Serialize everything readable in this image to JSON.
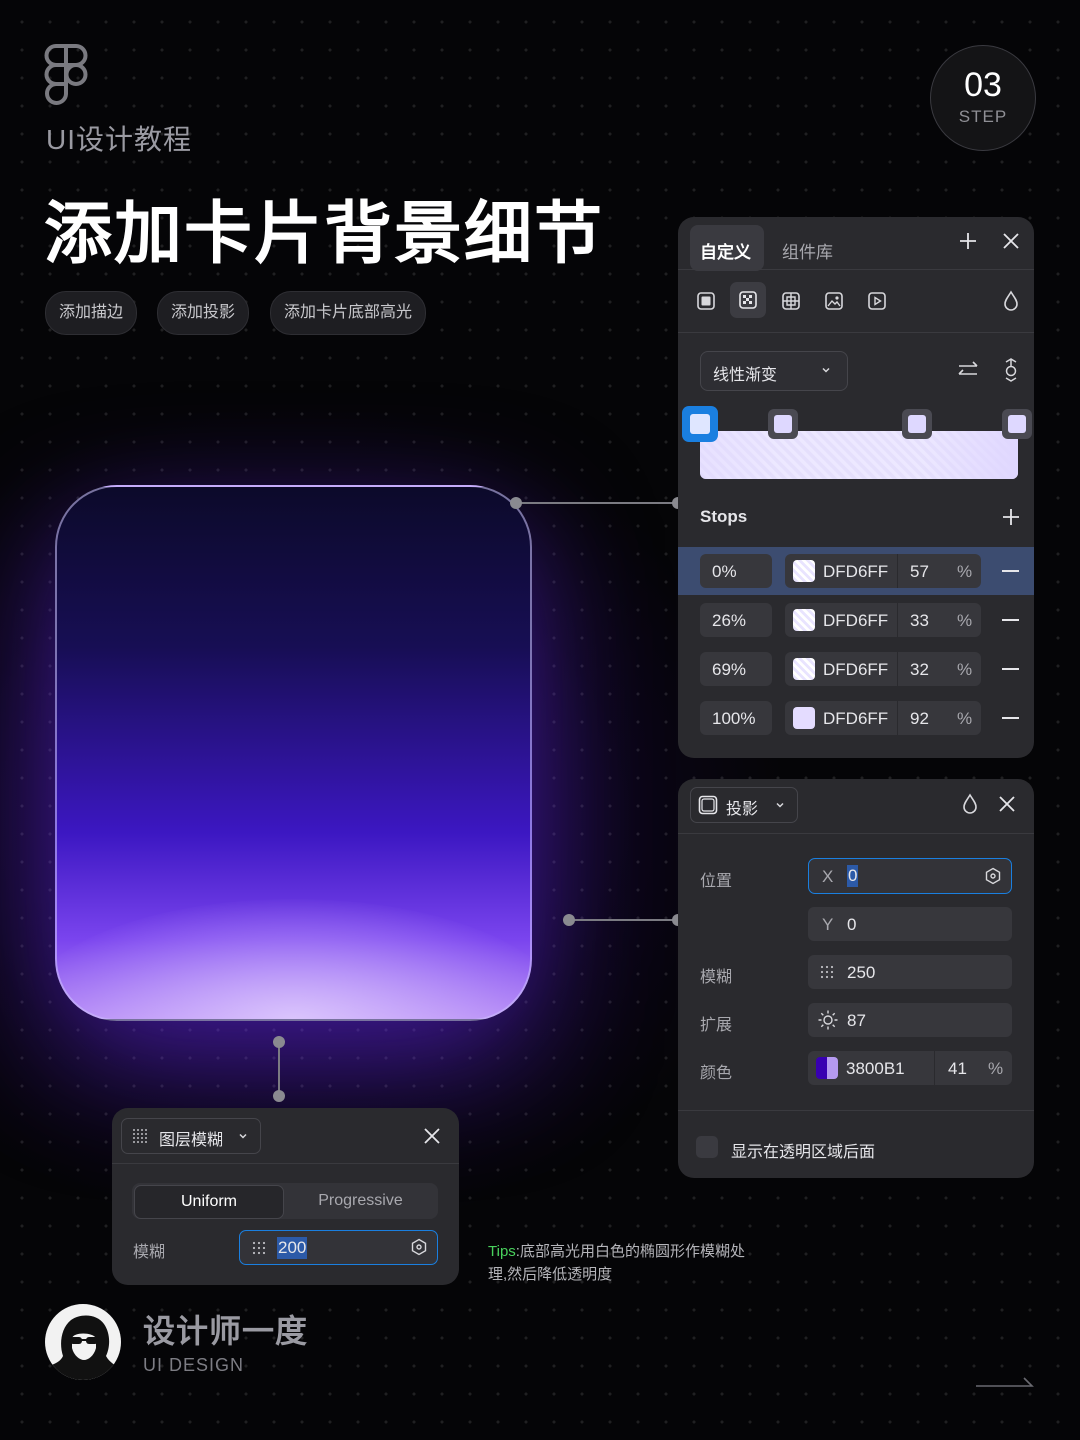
{
  "header": {
    "brand": "UI设计教程",
    "title": "添加卡片背景细节",
    "step_num": "03",
    "step_label": "STEP"
  },
  "chips": [
    "添加描边",
    "添加投影",
    "添加卡片底部高光"
  ],
  "fill_panel": {
    "tabs": [
      "自定义",
      "组件库"
    ],
    "gradient_type": "线性渐变",
    "stops_label": "Stops",
    "stops": [
      {
        "position": "0%",
        "hex": "DFD6FF",
        "opacity": "57",
        "unit": "%"
      },
      {
        "position": "26%",
        "hex": "DFD6FF",
        "opacity": "33",
        "unit": "%"
      },
      {
        "position": "69%",
        "hex": "DFD6FF",
        "opacity": "32",
        "unit": "%"
      },
      {
        "position": "100%",
        "hex": "DFD6FF",
        "opacity": "92",
        "unit": "%"
      }
    ],
    "accent": "#1a7fe0"
  },
  "shadow_panel": {
    "type": "投影",
    "position_label": "位置",
    "x_label": "X",
    "x_value": "0",
    "y_label": "Y",
    "y_value": "0",
    "blur_label": "模糊",
    "blur_value": "250",
    "spread_label": "扩展",
    "spread_value": "87",
    "color_label": "颜色",
    "color_hex": "3800B1",
    "color_opacity": "41",
    "unit": "%",
    "checkbox_label": "显示在透明区域后面"
  },
  "blur_panel": {
    "type": "图层模糊",
    "mode_uniform": "Uniform",
    "mode_progressive": "Progressive",
    "blur_label": "模糊",
    "blur_value": "200"
  },
  "tips": {
    "prefix": "Tips",
    "text": ":底部高光用白色的椭圆形作模糊处理,然后降低透明度"
  },
  "footer": {
    "name": "设计师一度",
    "sub": "UI DESIGN"
  }
}
